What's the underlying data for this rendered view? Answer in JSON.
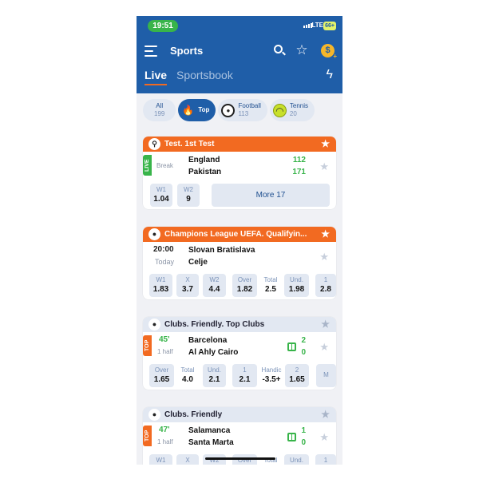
{
  "status": {
    "time": "19:51",
    "network": "LTE",
    "battery": "66+"
  },
  "header": {
    "title": "Sports",
    "coin_symbol": "$",
    "coin_plus": "+"
  },
  "tabs": {
    "live": "Live",
    "sportsbook": "Sportsbook"
  },
  "chips": [
    {
      "label": "All",
      "count": "199"
    },
    {
      "label": "Top",
      "count": ""
    },
    {
      "label": "Football",
      "count": "113"
    },
    {
      "label": "Tennis",
      "count": "20"
    }
  ],
  "cards": [
    {
      "title": "Test. 1st Test",
      "tag": "LIVE",
      "status": "Break",
      "team1": "England",
      "team2": "Pakistan",
      "score1": "112",
      "score2": "171",
      "odds": [
        {
          "label": "W1",
          "value": "1.04"
        },
        {
          "label": "W2",
          "value": "9"
        }
      ],
      "more": "More 17"
    },
    {
      "title": "Champions League UEFA. Qualifyin...",
      "time": "20:00",
      "day": "Today",
      "team1": "Slovan Bratislava",
      "team2": "Celje",
      "odds": [
        {
          "label": "W1",
          "value": "1.83"
        },
        {
          "label": "X",
          "value": "3.7"
        },
        {
          "label": "W2",
          "value": "4.4"
        },
        {
          "label": "Over",
          "value": "1.82"
        },
        {
          "label": "Total",
          "value": "2.5"
        },
        {
          "label": "Und.",
          "value": "1.98"
        },
        {
          "label": "1",
          "value": "2.8"
        }
      ]
    },
    {
      "title": "Clubs. Friendly. Top Clubs",
      "tag": "TOP",
      "minute": "45'",
      "period": "1 half",
      "team1": "Barcelona",
      "team2": "Al Ahly Cairo",
      "score1": "2",
      "score2": "0",
      "odds": [
        {
          "label": "Over",
          "value": "1.65"
        },
        {
          "label": "Total",
          "value": "4.0"
        },
        {
          "label": "Und.",
          "value": "2.1"
        },
        {
          "label": "1",
          "value": "2.1"
        },
        {
          "label": "Handic",
          "value": "-3.5+"
        },
        {
          "label": "2",
          "value": "1.65"
        },
        {
          "label": "M",
          "value": ""
        }
      ]
    },
    {
      "title": "Clubs. Friendly",
      "tag": "TOP",
      "minute": "47'",
      "period": "1 half",
      "team1": "Salamanca",
      "team2": "Santa Marta",
      "score1": "1",
      "score2": "0",
      "odds": [
        {
          "label": "W1"
        },
        {
          "label": "X"
        },
        {
          "label": "W2"
        },
        {
          "label": "Over"
        },
        {
          "label": "Total"
        },
        {
          "label": "Und."
        },
        {
          "label": "1"
        }
      ]
    }
  ],
  "colors": {
    "brand": "#1f5ea8",
    "accent": "#f26a21",
    "live": "#38b44a"
  }
}
